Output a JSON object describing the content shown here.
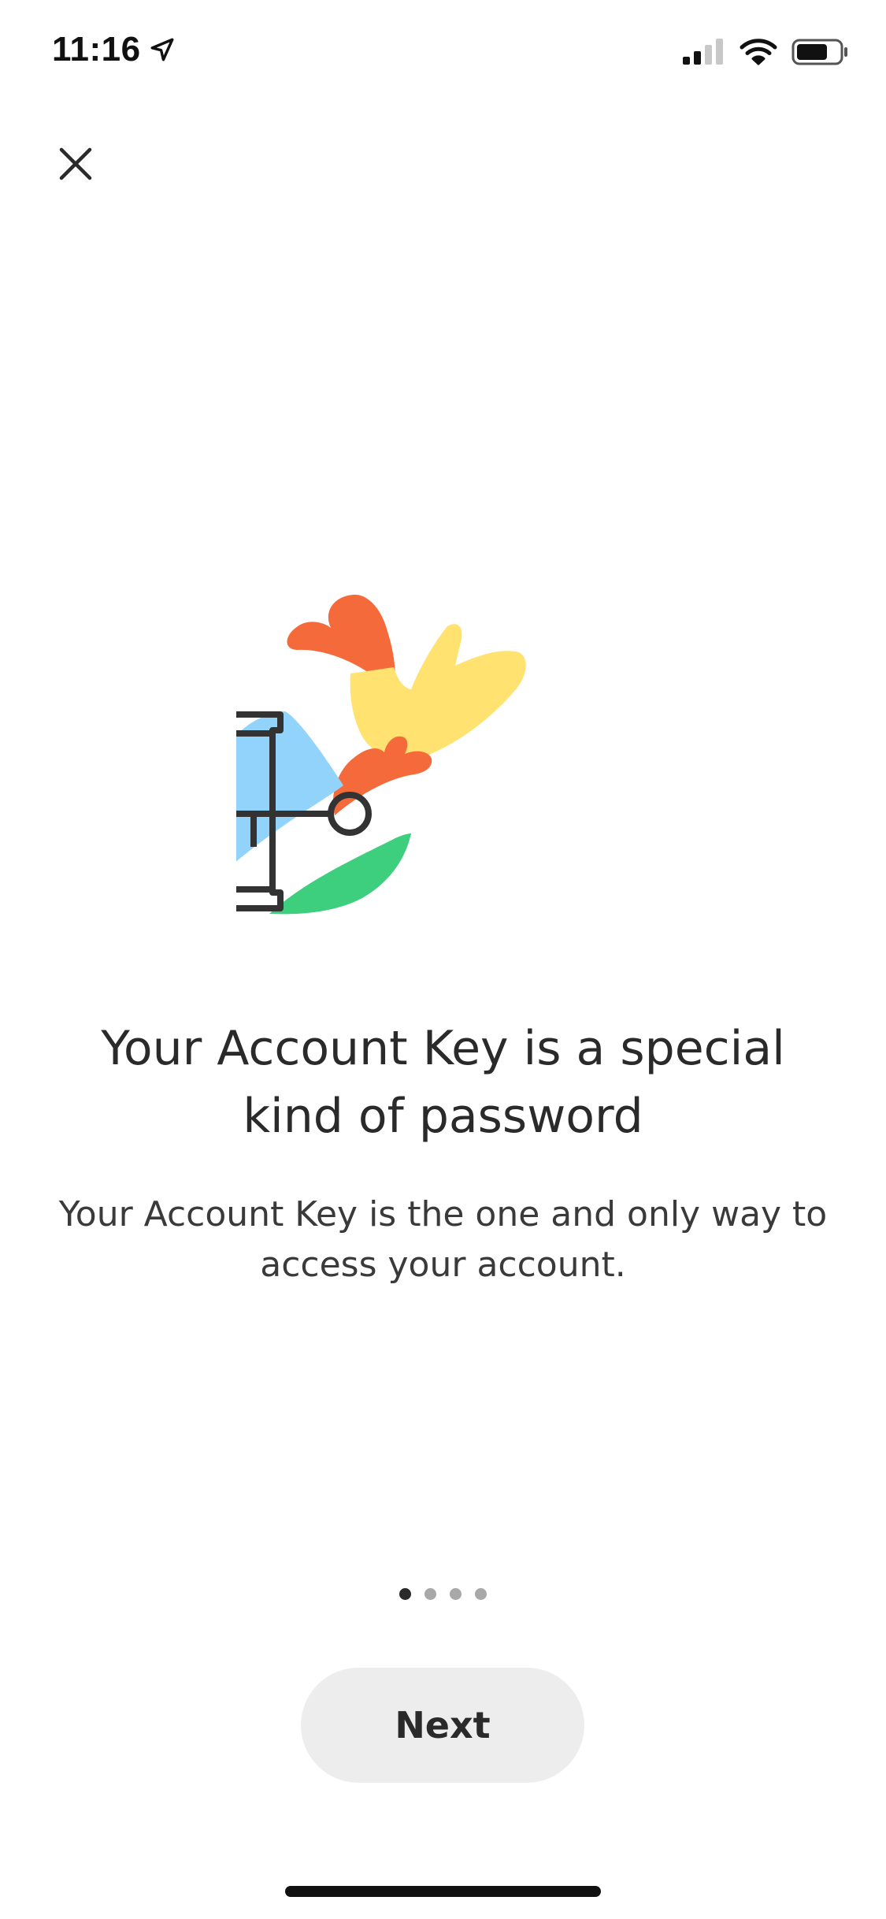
{
  "status_bar": {
    "time": "11:16",
    "icons": [
      "location-arrow-icon",
      "signal-icon",
      "wifi-icon",
      "battery-icon"
    ]
  },
  "header": {
    "close_icon": "close-icon"
  },
  "illustration": {
    "name": "account-key-illustration",
    "colors": {
      "orange": "#f56a3a",
      "yellow": "#ffe26f",
      "blue": "#92d3fb",
      "green": "#3ecf7e",
      "outline": "#333333"
    }
  },
  "content": {
    "headline": "Your Account Key is a special kind of password",
    "description": "Your Account Key is the one and only way to access your account."
  },
  "pagination": {
    "total": 4,
    "current": 1
  },
  "actions": {
    "next_label": "Next"
  }
}
